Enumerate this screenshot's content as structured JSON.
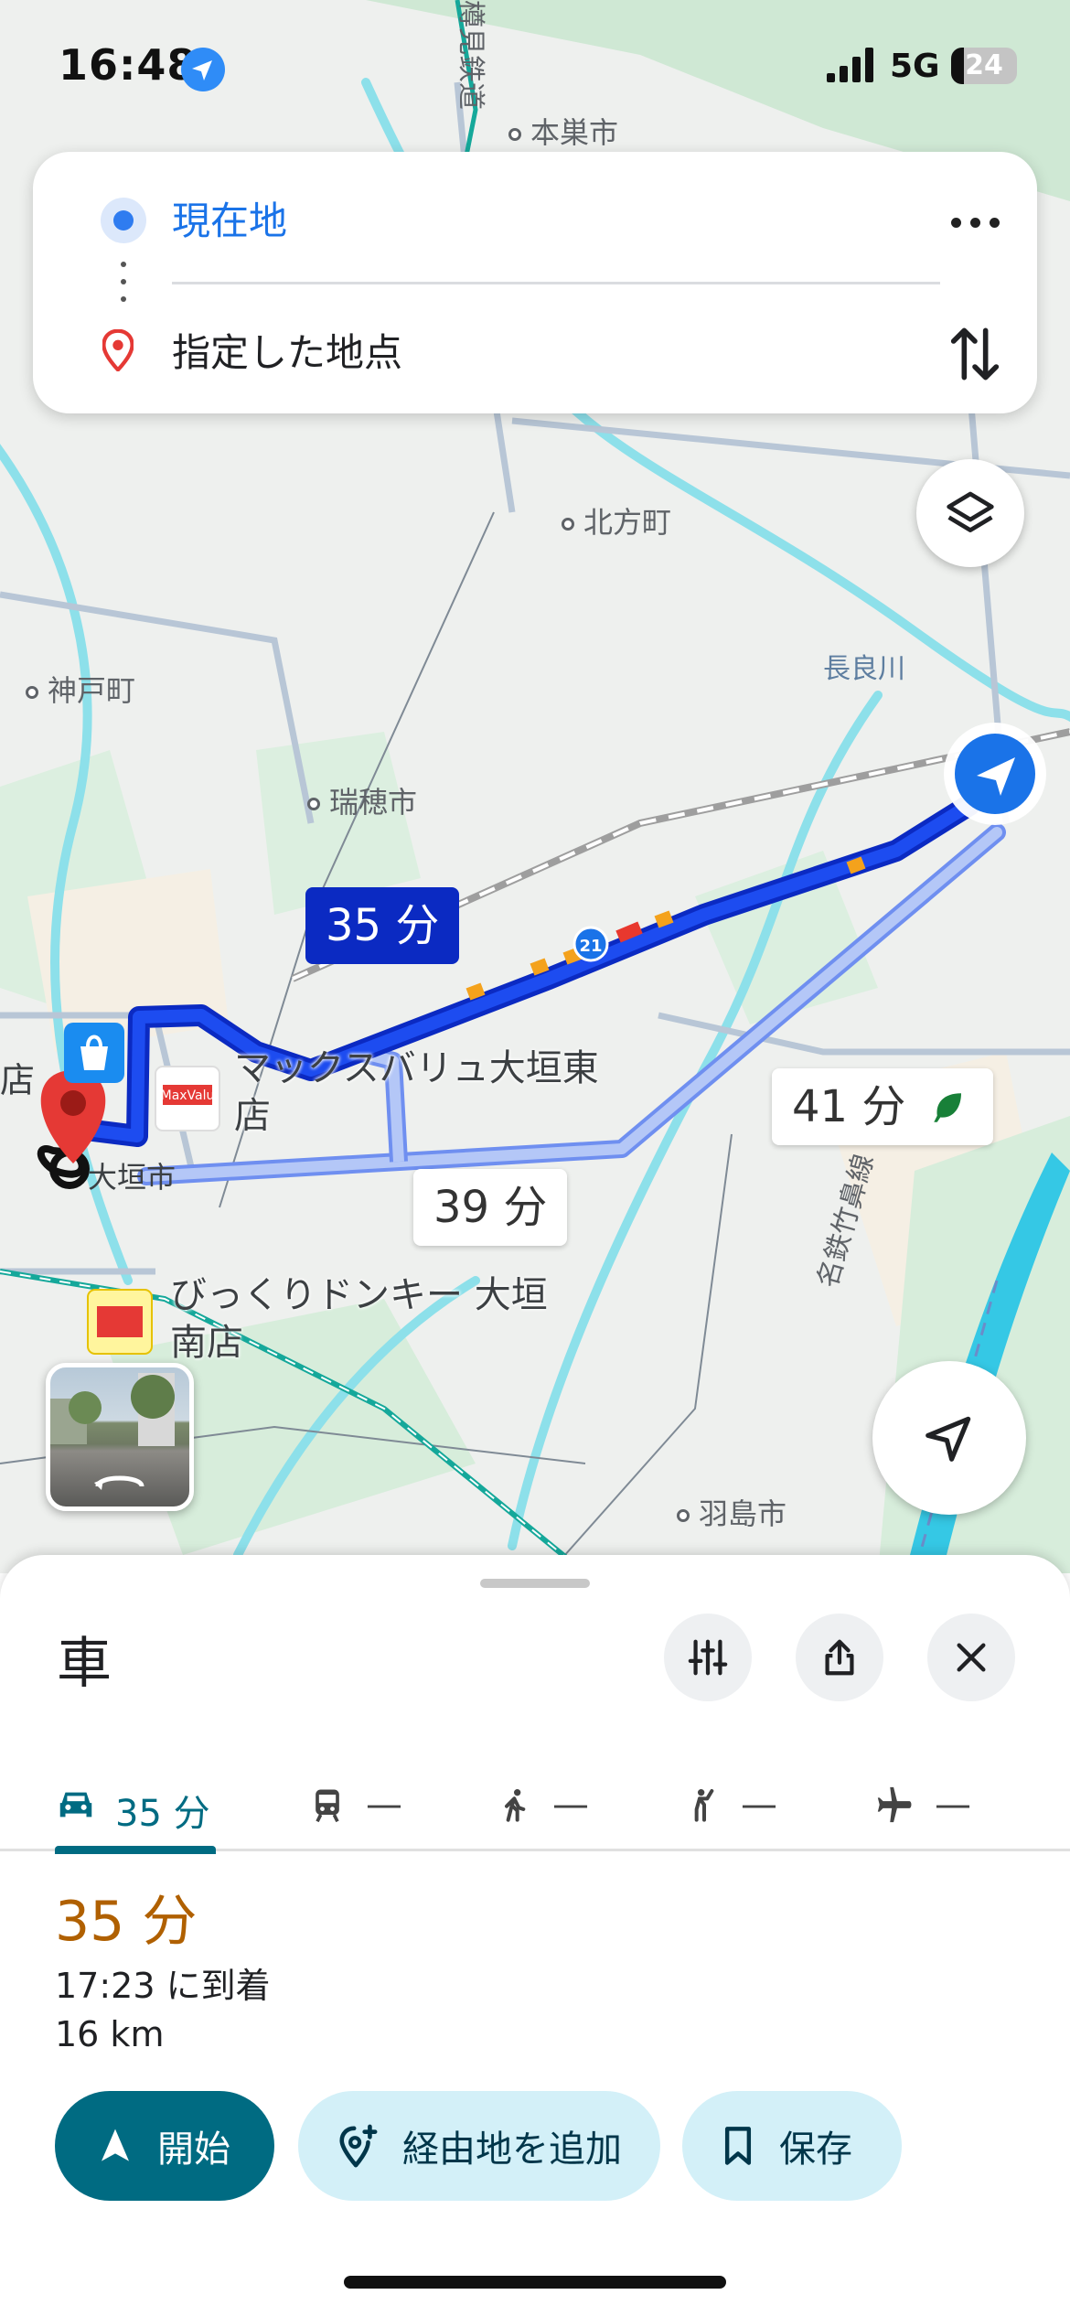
{
  "status_bar": {
    "time": "16:48",
    "network": "5G",
    "battery": "24"
  },
  "route_search": {
    "origin": "現在地",
    "destination": "指定した地点"
  },
  "map": {
    "places": {
      "motosu": "本巣市",
      "kitagata": "北方町",
      "godo": "神戸町",
      "mizuho": "瑞穂市",
      "ogaki": "大垣市",
      "hashima": "羽島市",
      "nagara_river": "長良川",
      "meitetsu": "名鉄竹鼻線",
      "tarumi": "樽見鉄道",
      "store_edge": "店",
      "route_shield": "21"
    },
    "pois": {
      "maxvalu": "マックスバリュ大垣東店",
      "donki": "びっくりドンキー 大垣南店"
    },
    "route_times": {
      "primary": "35 分",
      "alt1": "39 分",
      "alt2": "41 分"
    },
    "colors": {
      "primary_route": "#0b2ac2",
      "alt_route": "#8fa8f0"
    }
  },
  "sheet": {
    "mode_title": "車",
    "tabs": [
      {
        "icon": "car-icon",
        "label": "35 分"
      },
      {
        "icon": "train-icon",
        "label": "—"
      },
      {
        "icon": "walk-icon",
        "label": "—"
      },
      {
        "icon": "ride-hail-icon",
        "label": "—"
      },
      {
        "icon": "flight-icon",
        "label": "—"
      }
    ],
    "duration": "35 分",
    "arrival": "17:23 に到着",
    "distance": "16 km",
    "buttons": {
      "start": "開始",
      "add_waypoint": "経由地を追加",
      "save": "保存"
    }
  }
}
